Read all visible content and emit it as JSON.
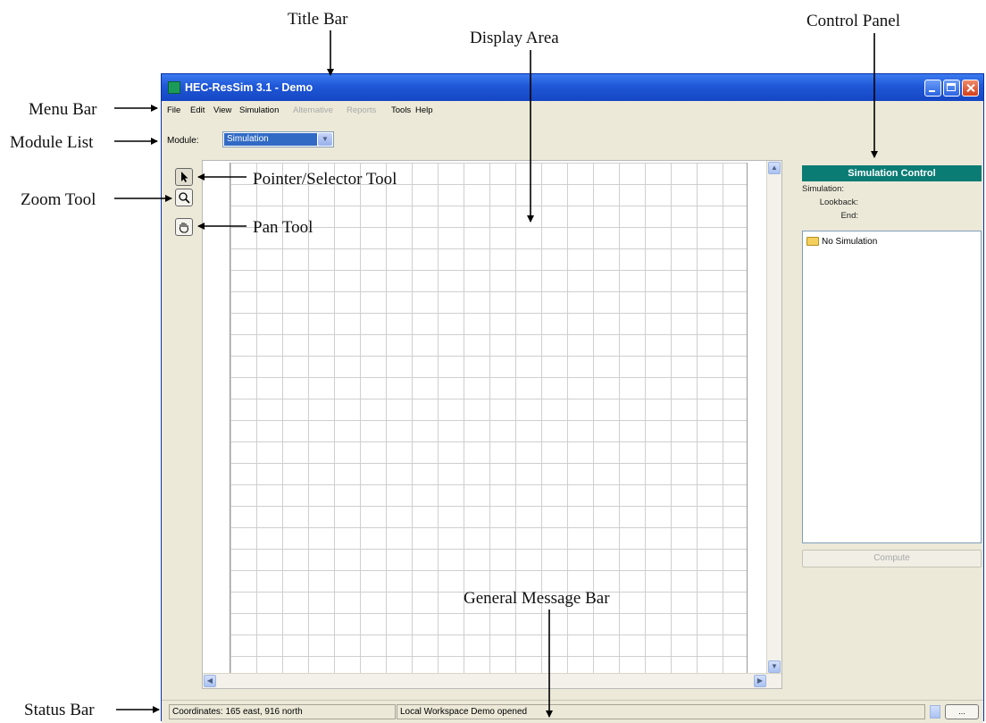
{
  "annotations": {
    "title_bar": "Title Bar",
    "display_area": "Display Area",
    "control_panel": "Control Panel",
    "menu_bar": "Menu Bar",
    "module_list": "Module List",
    "zoom_tool": "Zoom Tool",
    "pointer_tool": "Pointer/Selector Tool",
    "pan_tool": "Pan Tool",
    "general_message_bar": "General Message Bar",
    "status_bar": "Status Bar"
  },
  "window": {
    "title": "HEC-ResSim 3.1  - Demo"
  },
  "menu": {
    "items": [
      {
        "label": "File",
        "enabled": true
      },
      {
        "label": "Edit",
        "enabled": true
      },
      {
        "label": "View",
        "enabled": true
      },
      {
        "label": "Simulation",
        "enabled": true
      },
      {
        "label": "Alternative",
        "enabled": false
      },
      {
        "label": "Reports",
        "enabled": false
      },
      {
        "label": "Tools",
        "enabled": true
      },
      {
        "label": "Help",
        "enabled": true
      }
    ]
  },
  "module": {
    "label": "Module:",
    "selected": "Simulation"
  },
  "tools": [
    "pointer-icon",
    "magnifier-icon",
    "hand-icon"
  ],
  "control_panel": {
    "header": "Simulation Control",
    "fields": [
      "Simulation:",
      "Lookback:",
      "End:"
    ],
    "tree_item": "No Simulation",
    "compute_label": "Compute"
  },
  "status": {
    "coordinates": "Coordinates: 165 east, 916 north",
    "message": "Local Workspace Demo opened",
    "more_label": "..."
  },
  "colors": {
    "titlebar": "#1f57d6",
    "control_header": "#0a7c74",
    "window_bg": "#ece9d8",
    "selection": "#316ac5"
  }
}
